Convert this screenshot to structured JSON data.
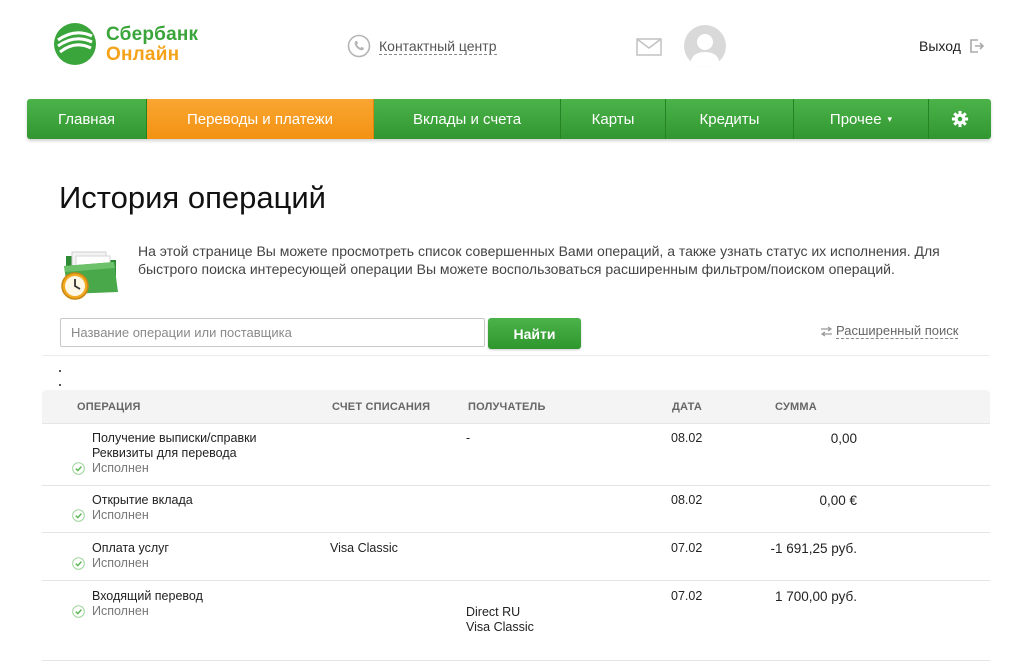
{
  "header": {
    "logo_line1": "Сбербанк",
    "logo_line2": "Онлайн",
    "contact_label": "Контактный центр",
    "logout_label": "Выход"
  },
  "nav": {
    "items": [
      {
        "label": "Главная",
        "active": false
      },
      {
        "label": "Переводы и платежи",
        "active": true
      },
      {
        "label": "Вклады и счета",
        "active": false
      },
      {
        "label": "Карты",
        "active": false
      },
      {
        "label": "Кредиты",
        "active": false
      },
      {
        "label": "Прочее",
        "active": false,
        "has_dropdown": true
      }
    ],
    "settings_icon": "gear-icon"
  },
  "page": {
    "title": "История операций",
    "intro": "На этой странице Вы можете просмотреть список совершенных Вами операций, а также узнать статус их исполнения. Для быстрого поиска интересующей операции Вы можете воспользоваться расширенным фильтром/поиском операций."
  },
  "search": {
    "placeholder": "Название операции или поставщика",
    "value": "",
    "button_label": "Найти",
    "advanced_label": "Расширенный поиск"
  },
  "table": {
    "columns": {
      "operation": "ОПЕРАЦИЯ",
      "account": "СЧЕТ СПИСАНИЯ",
      "recipient": "ПОЛУЧАТЕЛЬ",
      "date": "ДАТА",
      "amount": "СУММА"
    },
    "rows": [
      {
        "operation_line1": "Получение выписки/справки",
        "operation_line2": "Реквизиты для перевода",
        "status": "Исполнен",
        "account": "",
        "recipient_line1": "-",
        "recipient_line2": "",
        "date": "08.02",
        "amount": "0,00"
      },
      {
        "operation_line1": "Открытие вклада",
        "operation_line2": "",
        "status": "Исполнен",
        "account": "",
        "recipient_line1": "",
        "recipient_line2": "",
        "date": "08.02",
        "amount": "0,00 €"
      },
      {
        "operation_line1": "Оплата услуг",
        "operation_line2": "",
        "status": "Исполнен",
        "account": "Visa Classic",
        "recipient_line1": "",
        "recipient_line2": "",
        "date": "07.02",
        "amount": "-1 691,25 руб."
      },
      {
        "operation_line1": "Входящий перевод",
        "operation_line2": "",
        "status": "Исполнен",
        "account": "",
        "recipient_line1": "Direct RU",
        "recipient_line2": "Visa Classic",
        "date": "07.02",
        "amount": "1 700,00 руб."
      }
    ]
  },
  "colors": {
    "brand_green": "#3aa53a",
    "brand_orange": "#f4a21a",
    "nav_green": "#31962f",
    "nav_active": "#f39212"
  }
}
